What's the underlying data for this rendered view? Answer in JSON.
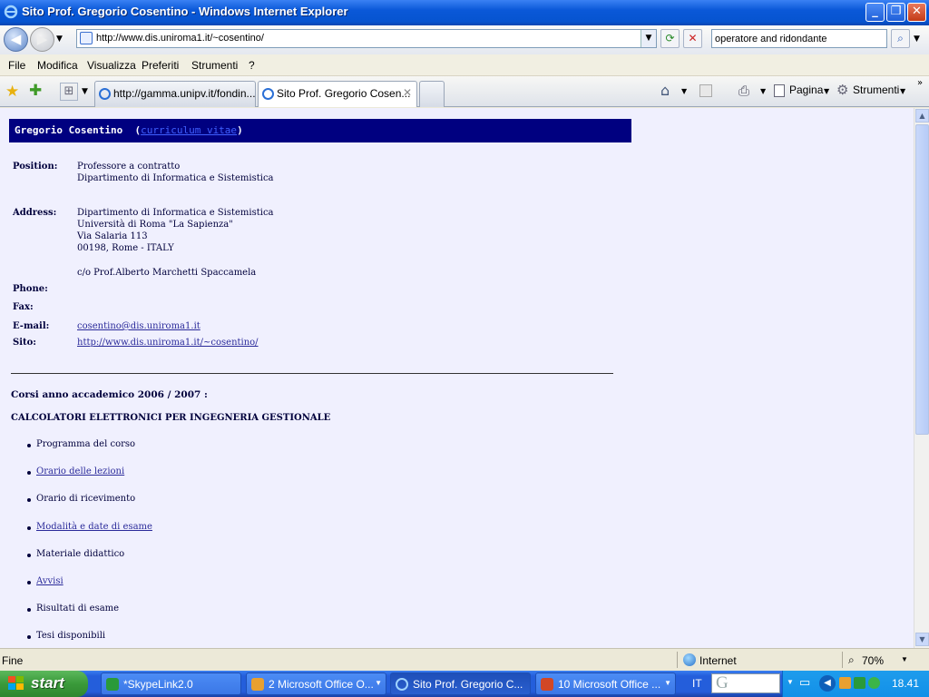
{
  "window": {
    "title": "Sito Prof. Gregorio Cosentino - Windows Internet Explorer"
  },
  "nav": {
    "url": "http://www.dis.uniroma1.it/~cosentino/",
    "search_value": "operatore and ridondante"
  },
  "menu": [
    "File",
    "Modifica",
    "Visualizza",
    "Preferiti",
    "Strumenti",
    "?"
  ],
  "tabs": [
    {
      "label": "http://gamma.unipv.it/fondin..."
    },
    {
      "label": "Sito Prof. Gregorio Cosen..."
    }
  ],
  "toolbar": {
    "page": "Pagina",
    "tools": "Strumenti"
  },
  "page": {
    "banner_name": "Gregorio Cosentino",
    "banner_link": "curriculum vitae",
    "position_label": "Position:",
    "position": [
      "Professore a contratto",
      "Dipartimento di Informatica e Sistemistica"
    ],
    "address_label": "Address:",
    "address": [
      "Dipartimento di Informatica e Sistemistica",
      "Università di Roma \"La Sapienza\"",
      "Via Salaria 113",
      "00198, Rome - ITALY"
    ],
    "address_co": "c/o Prof.Alberto Marchetti Spaccamela",
    "phone_label": "Phone:",
    "fax_label": "Fax:",
    "email_label": "E-mail:",
    "email": "cosentino@dis.uniroma1.it",
    "site_label": "Sito:",
    "site": "http://www.dis.uniroma1.it/~cosentino/",
    "courses_heading": "Corsi anno accademico 2006 / 2007 :",
    "course_title": "CALCOLATORI ELETTRONICI PER INGEGNERIA GESTIONALE",
    "course_items": [
      {
        "label": "Programma del corso",
        "link": false
      },
      {
        "label": "Orario delle lezioni",
        "link": true
      },
      {
        "label": "Orario di ricevimento",
        "link": false
      },
      {
        "label": "Modalità e date di esame",
        "link": true
      },
      {
        "label": "Materiale didattico",
        "link": false
      },
      {
        "label": "Avvisi",
        "link": true
      },
      {
        "label": "Risultati di esame",
        "link": false
      },
      {
        "label": "Tesi disponibili",
        "link": false
      }
    ]
  },
  "status": {
    "text": "Fine",
    "zone": "Internet",
    "zoom": "70%"
  },
  "taskbar": {
    "start": "start",
    "tasks": [
      "*SkypeLink2.0",
      "2 Microsoft Office O...",
      "Sito Prof. Gregorio C...",
      "10 Microsoft Office ..."
    ],
    "lang": "IT",
    "clock": "18.41"
  }
}
